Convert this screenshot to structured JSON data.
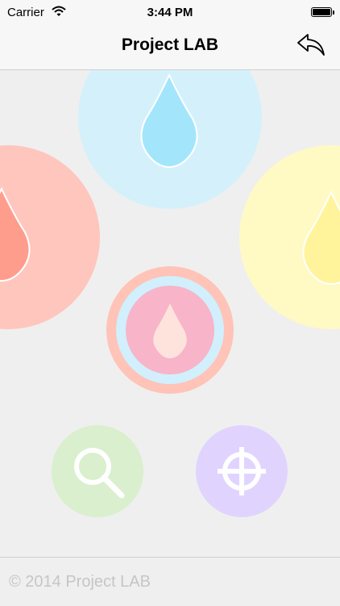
{
  "status_bar": {
    "carrier": "Carrier",
    "time": "3:44 PM"
  },
  "nav": {
    "title": "Project LAB",
    "back_icon": "reply-arrow-icon"
  },
  "circles": {
    "top": {
      "icon": "water-drop-icon",
      "color": "#d4f1fb",
      "drop_color": "#a3e6fb"
    },
    "left": {
      "icon": "water-drop-icon",
      "color": "#ffc6bd",
      "drop_color": "#ff9d8d"
    },
    "right": {
      "icon": "water-drop-icon",
      "color": "#fff9c4",
      "drop_color": "#fff49b"
    },
    "center": {
      "icon": "water-drop-icon",
      "ring_colors": [
        "#ffc3b7",
        "#d1effc",
        "#f8b4c9"
      ],
      "drop_color": "#fee3dc"
    }
  },
  "actions": {
    "search": {
      "icon": "search-icon",
      "color": "#d9efcd"
    },
    "locate": {
      "icon": "crosshair-icon",
      "color": "#e0d4ff"
    }
  },
  "footer": {
    "copyright": "© 2014 Project LAB"
  }
}
